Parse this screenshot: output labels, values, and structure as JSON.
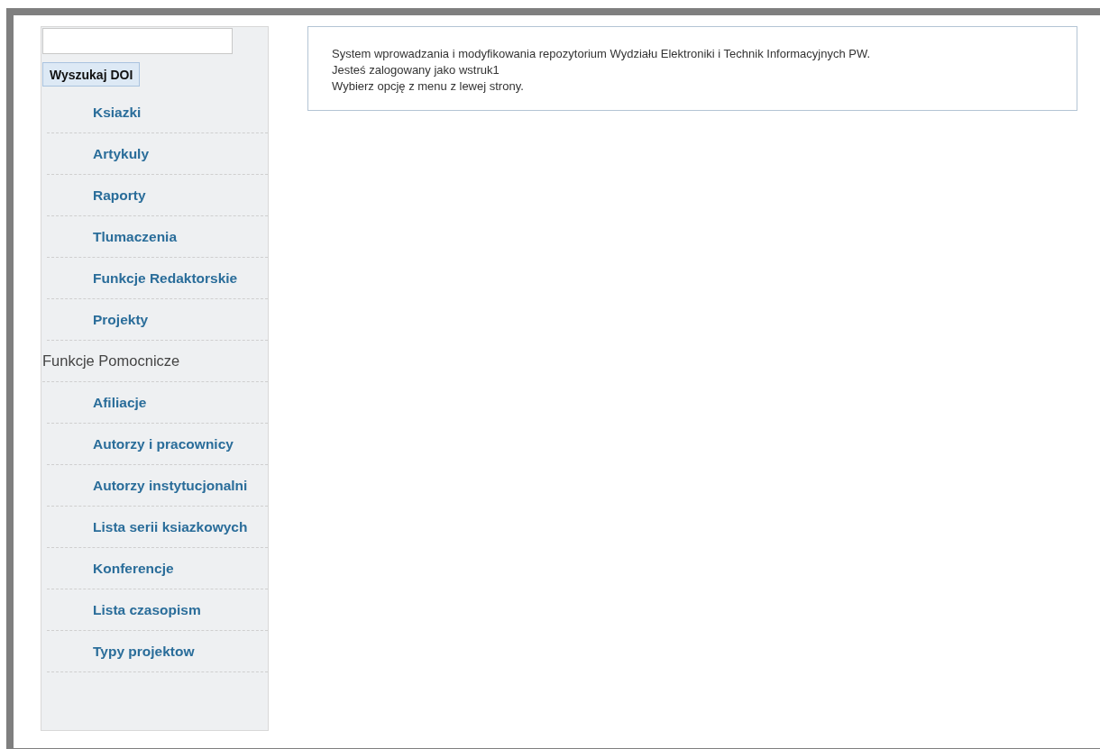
{
  "search": {
    "button": "Wyszukaj DOI"
  },
  "menu": [
    {
      "kind": "link",
      "label": "Ksiazki"
    },
    {
      "kind": "link",
      "label": "Artykuly"
    },
    {
      "kind": "link",
      "label": "Raporty"
    },
    {
      "kind": "link",
      "label": "Tlumaczenia"
    },
    {
      "kind": "link",
      "label": "Funkcje Redaktorskie"
    },
    {
      "kind": "link",
      "label": "Projekty"
    },
    {
      "kind": "heading",
      "label": "Funkcje Pomocnicze"
    },
    {
      "kind": "link",
      "label": "Afiliacje"
    },
    {
      "kind": "link",
      "label": "Autorzy i pracownicy"
    },
    {
      "kind": "link",
      "label": "Autorzy instytucjonalni"
    },
    {
      "kind": "link",
      "label": "Lista serii ksiazkowych"
    },
    {
      "kind": "link",
      "label": "Konferencje"
    },
    {
      "kind": "link",
      "label": "Lista czasopism"
    },
    {
      "kind": "link",
      "label": "Typy projektow"
    }
  ],
  "info": {
    "lines": [
      "System wprowadzania i modyfikowania repozytorium Wydziału Elektroniki i Technik Informacyjnych PW.",
      "Jesteś zalogowany jako wstruk1",
      "Wybierz opcję z menu z lewej strony."
    ]
  }
}
